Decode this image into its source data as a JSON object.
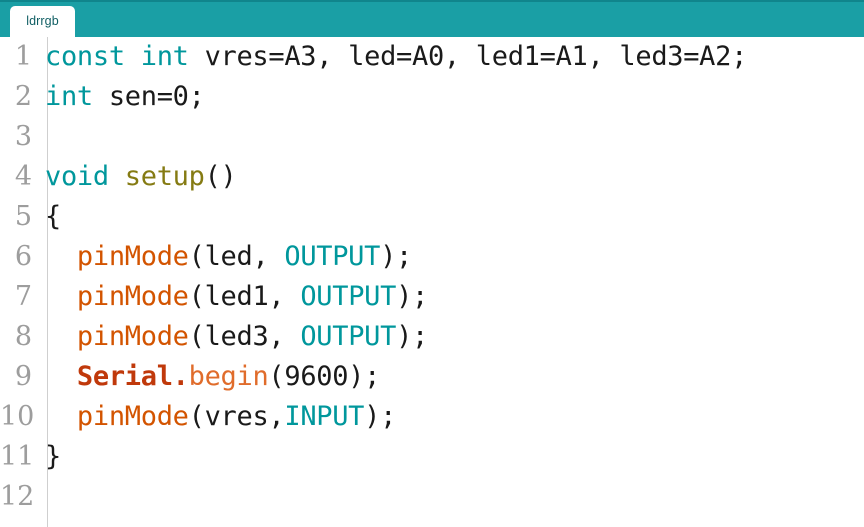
{
  "window": {
    "title": "ldrrgb",
    "accent_color": "#1a9fa5",
    "accent_dark": "#10858c",
    "background": "#ffffff"
  },
  "tabbar": {
    "tabs": [
      {
        "label": "ldrrgb",
        "active": true
      }
    ]
  },
  "editor": {
    "gutter": {
      "line_numbers": [
        "1",
        "2",
        "3",
        "4",
        "5",
        "6",
        "7",
        "8",
        "9",
        "10",
        "11",
        "12"
      ],
      "color": "#9d9d9d"
    },
    "language": "arduino-cpp",
    "syntax_colors": {
      "keyword": "#00979c",
      "constant": "#00979c",
      "function": "#d35400",
      "object": "#c0390b",
      "method": "#e06c2b",
      "identifier": "#1a1a1a",
      "setup_name": "#857b13",
      "punctuation": "#1a1a1a"
    },
    "lines": [
      {
        "number": "1",
        "tokens": [
          {
            "text": "const int",
            "type": "keyword"
          },
          {
            "text": " vres=A3, led=A0, led1=A1, led3=A2;",
            "type": "plain"
          }
        ]
      },
      {
        "number": "2",
        "tokens": [
          {
            "text": "int",
            "type": "keyword"
          },
          {
            "text": " sen=0;",
            "type": "plain"
          }
        ]
      },
      {
        "number": "3",
        "tokens": []
      },
      {
        "number": "4",
        "tokens": [
          {
            "text": "void",
            "type": "keyword"
          },
          {
            "text": " ",
            "type": "plain"
          },
          {
            "text": "setup",
            "type": "setup_name"
          },
          {
            "text": "()",
            "type": "punctuation"
          }
        ]
      },
      {
        "number": "5",
        "tokens": [
          {
            "text": "{",
            "type": "punctuation"
          }
        ]
      },
      {
        "number": "6",
        "tokens": [
          {
            "text": "  ",
            "type": "plain"
          },
          {
            "text": "pinMode",
            "type": "function"
          },
          {
            "text": "(led, ",
            "type": "plain"
          },
          {
            "text": "OUTPUT",
            "type": "constant"
          },
          {
            "text": ");",
            "type": "plain"
          }
        ]
      },
      {
        "number": "7",
        "tokens": [
          {
            "text": "  ",
            "type": "plain"
          },
          {
            "text": "pinMode",
            "type": "function"
          },
          {
            "text": "(led1, ",
            "type": "plain"
          },
          {
            "text": "OUTPUT",
            "type": "constant"
          },
          {
            "text": ");",
            "type": "plain"
          }
        ]
      },
      {
        "number": "8",
        "tokens": [
          {
            "text": "  ",
            "type": "plain"
          },
          {
            "text": "pinMode",
            "type": "function"
          },
          {
            "text": "(led3, ",
            "type": "plain"
          },
          {
            "text": "OUTPUT",
            "type": "constant"
          },
          {
            "text": ");",
            "type": "plain"
          }
        ]
      },
      {
        "number": "9",
        "tokens": [
          {
            "text": "  ",
            "type": "plain"
          },
          {
            "text": "Serial",
            "type": "object"
          },
          {
            "text": ".",
            "type": "object"
          },
          {
            "text": "begin",
            "type": "method"
          },
          {
            "text": "(9600);",
            "type": "plain"
          }
        ]
      },
      {
        "number": "10",
        "tokens": [
          {
            "text": "  ",
            "type": "plain"
          },
          {
            "text": "pinMode",
            "type": "function"
          },
          {
            "text": "(vres,",
            "type": "plain"
          },
          {
            "text": "INPUT",
            "type": "constant"
          },
          {
            "text": ");",
            "type": "plain"
          }
        ]
      },
      {
        "number": "11",
        "tokens": [
          {
            "text": "}",
            "type": "punctuation"
          }
        ]
      },
      {
        "number": "12",
        "tokens": []
      }
    ]
  }
}
